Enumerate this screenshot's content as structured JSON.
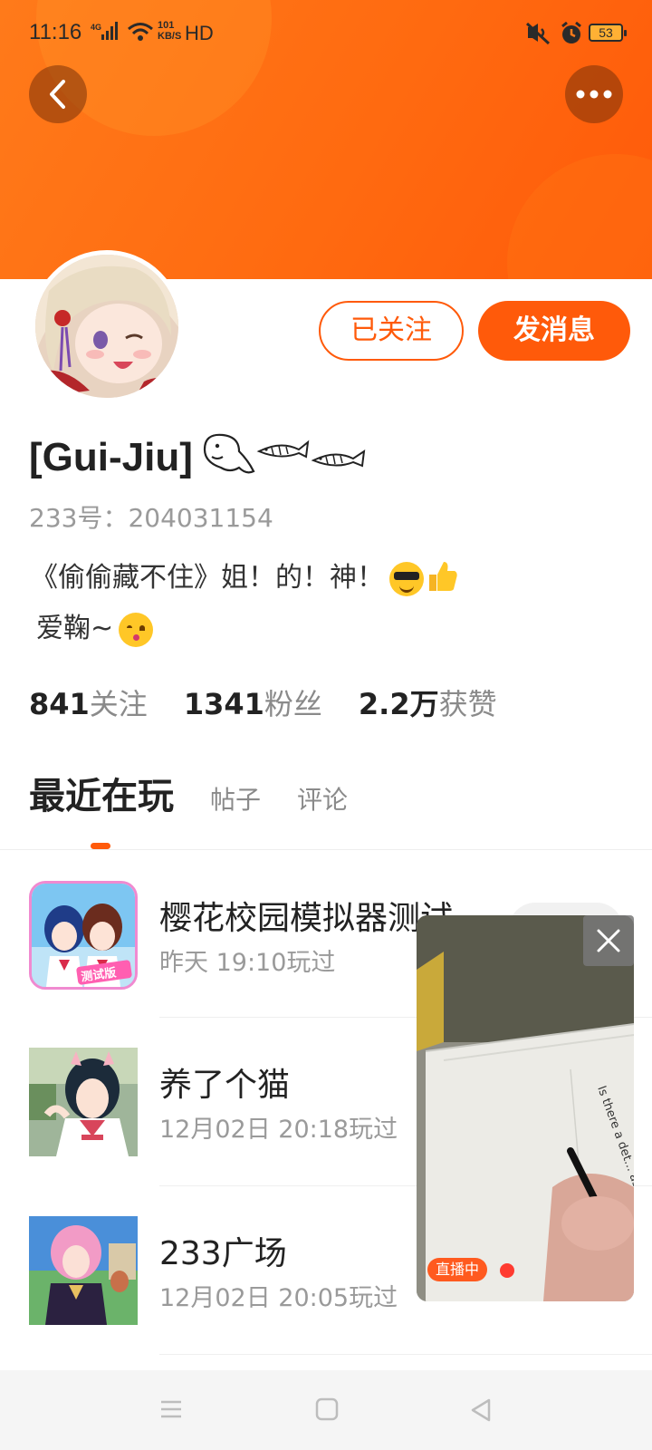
{
  "status_bar": {
    "time": "11:16",
    "network": "4G",
    "speed_value": "101",
    "speed_unit": "KB/S",
    "hd": "HD",
    "battery": "53"
  },
  "header": {
    "accent_color": "#ff5a0a"
  },
  "profile": {
    "username": "[Gui-Jiu]",
    "id_line": "233号：204031154",
    "bio_line1": "《偷偷藏不住》姐！的！神！",
    "bio_line2": "爱鞠~",
    "follow_label": "已关注",
    "message_label": "发消息"
  },
  "stats": [
    {
      "value": "841",
      "label": "关注"
    },
    {
      "value": "1341",
      "label": "粉丝"
    },
    {
      "value": "2.2万",
      "label": "获赞"
    }
  ],
  "tabs": {
    "active": "最近在玩",
    "items": [
      "帖子",
      "评论"
    ]
  },
  "games": [
    {
      "title": "樱花校园模拟器测试",
      "time": "昨天 19:10玩过",
      "icon_tag": "测试版"
    },
    {
      "title": "养了个猫",
      "time": "12月02日 20:18玩过"
    },
    {
      "title": "233广场",
      "time": "12月02日 20:05玩过"
    }
  ],
  "live": {
    "badge": "直播中",
    "paper_text": "Is there a det... as sta... No..."
  }
}
